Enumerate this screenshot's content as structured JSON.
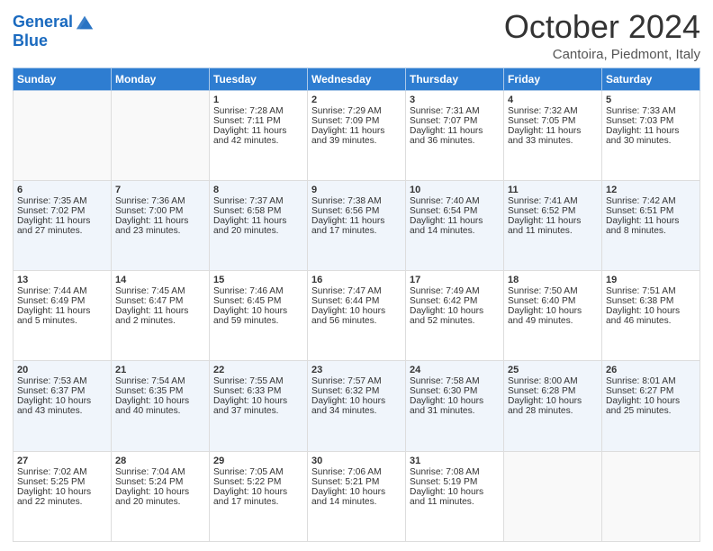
{
  "header": {
    "logo_line1": "General",
    "logo_line2": "Blue",
    "month": "October 2024",
    "location": "Cantoira, Piedmont, Italy"
  },
  "weekdays": [
    "Sunday",
    "Monday",
    "Tuesday",
    "Wednesday",
    "Thursday",
    "Friday",
    "Saturday"
  ],
  "weeks": [
    [
      {
        "day": "",
        "sunrise": "",
        "sunset": "",
        "daylight": ""
      },
      {
        "day": "",
        "sunrise": "",
        "sunset": "",
        "daylight": ""
      },
      {
        "day": "1",
        "sunrise": "Sunrise: 7:28 AM",
        "sunset": "Sunset: 7:11 PM",
        "daylight": "Daylight: 11 hours and 42 minutes."
      },
      {
        "day": "2",
        "sunrise": "Sunrise: 7:29 AM",
        "sunset": "Sunset: 7:09 PM",
        "daylight": "Daylight: 11 hours and 39 minutes."
      },
      {
        "day": "3",
        "sunrise": "Sunrise: 7:31 AM",
        "sunset": "Sunset: 7:07 PM",
        "daylight": "Daylight: 11 hours and 36 minutes."
      },
      {
        "day": "4",
        "sunrise": "Sunrise: 7:32 AM",
        "sunset": "Sunset: 7:05 PM",
        "daylight": "Daylight: 11 hours and 33 minutes."
      },
      {
        "day": "5",
        "sunrise": "Sunrise: 7:33 AM",
        "sunset": "Sunset: 7:03 PM",
        "daylight": "Daylight: 11 hours and 30 minutes."
      }
    ],
    [
      {
        "day": "6",
        "sunrise": "Sunrise: 7:35 AM",
        "sunset": "Sunset: 7:02 PM",
        "daylight": "Daylight: 11 hours and 27 minutes."
      },
      {
        "day": "7",
        "sunrise": "Sunrise: 7:36 AM",
        "sunset": "Sunset: 7:00 PM",
        "daylight": "Daylight: 11 hours and 23 minutes."
      },
      {
        "day": "8",
        "sunrise": "Sunrise: 7:37 AM",
        "sunset": "Sunset: 6:58 PM",
        "daylight": "Daylight: 11 hours and 20 minutes."
      },
      {
        "day": "9",
        "sunrise": "Sunrise: 7:38 AM",
        "sunset": "Sunset: 6:56 PM",
        "daylight": "Daylight: 11 hours and 17 minutes."
      },
      {
        "day": "10",
        "sunrise": "Sunrise: 7:40 AM",
        "sunset": "Sunset: 6:54 PM",
        "daylight": "Daylight: 11 hours and 14 minutes."
      },
      {
        "day": "11",
        "sunrise": "Sunrise: 7:41 AM",
        "sunset": "Sunset: 6:52 PM",
        "daylight": "Daylight: 11 hours and 11 minutes."
      },
      {
        "day": "12",
        "sunrise": "Sunrise: 7:42 AM",
        "sunset": "Sunset: 6:51 PM",
        "daylight": "Daylight: 11 hours and 8 minutes."
      }
    ],
    [
      {
        "day": "13",
        "sunrise": "Sunrise: 7:44 AM",
        "sunset": "Sunset: 6:49 PM",
        "daylight": "Daylight: 11 hours and 5 minutes."
      },
      {
        "day": "14",
        "sunrise": "Sunrise: 7:45 AM",
        "sunset": "Sunset: 6:47 PM",
        "daylight": "Daylight: 11 hours and 2 minutes."
      },
      {
        "day": "15",
        "sunrise": "Sunrise: 7:46 AM",
        "sunset": "Sunset: 6:45 PM",
        "daylight": "Daylight: 10 hours and 59 minutes."
      },
      {
        "day": "16",
        "sunrise": "Sunrise: 7:47 AM",
        "sunset": "Sunset: 6:44 PM",
        "daylight": "Daylight: 10 hours and 56 minutes."
      },
      {
        "day": "17",
        "sunrise": "Sunrise: 7:49 AM",
        "sunset": "Sunset: 6:42 PM",
        "daylight": "Daylight: 10 hours and 52 minutes."
      },
      {
        "day": "18",
        "sunrise": "Sunrise: 7:50 AM",
        "sunset": "Sunset: 6:40 PM",
        "daylight": "Daylight: 10 hours and 49 minutes."
      },
      {
        "day": "19",
        "sunrise": "Sunrise: 7:51 AM",
        "sunset": "Sunset: 6:38 PM",
        "daylight": "Daylight: 10 hours and 46 minutes."
      }
    ],
    [
      {
        "day": "20",
        "sunrise": "Sunrise: 7:53 AM",
        "sunset": "Sunset: 6:37 PM",
        "daylight": "Daylight: 10 hours and 43 minutes."
      },
      {
        "day": "21",
        "sunrise": "Sunrise: 7:54 AM",
        "sunset": "Sunset: 6:35 PM",
        "daylight": "Daylight: 10 hours and 40 minutes."
      },
      {
        "day": "22",
        "sunrise": "Sunrise: 7:55 AM",
        "sunset": "Sunset: 6:33 PM",
        "daylight": "Daylight: 10 hours and 37 minutes."
      },
      {
        "day": "23",
        "sunrise": "Sunrise: 7:57 AM",
        "sunset": "Sunset: 6:32 PM",
        "daylight": "Daylight: 10 hours and 34 minutes."
      },
      {
        "day": "24",
        "sunrise": "Sunrise: 7:58 AM",
        "sunset": "Sunset: 6:30 PM",
        "daylight": "Daylight: 10 hours and 31 minutes."
      },
      {
        "day": "25",
        "sunrise": "Sunrise: 8:00 AM",
        "sunset": "Sunset: 6:28 PM",
        "daylight": "Daylight: 10 hours and 28 minutes."
      },
      {
        "day": "26",
        "sunrise": "Sunrise: 8:01 AM",
        "sunset": "Sunset: 6:27 PM",
        "daylight": "Daylight: 10 hours and 25 minutes."
      }
    ],
    [
      {
        "day": "27",
        "sunrise": "Sunrise: 7:02 AM",
        "sunset": "Sunset: 5:25 PM",
        "daylight": "Daylight: 10 hours and 22 minutes."
      },
      {
        "day": "28",
        "sunrise": "Sunrise: 7:04 AM",
        "sunset": "Sunset: 5:24 PM",
        "daylight": "Daylight: 10 hours and 20 minutes."
      },
      {
        "day": "29",
        "sunrise": "Sunrise: 7:05 AM",
        "sunset": "Sunset: 5:22 PM",
        "daylight": "Daylight: 10 hours and 17 minutes."
      },
      {
        "day": "30",
        "sunrise": "Sunrise: 7:06 AM",
        "sunset": "Sunset: 5:21 PM",
        "daylight": "Daylight: 10 hours and 14 minutes."
      },
      {
        "day": "31",
        "sunrise": "Sunrise: 7:08 AM",
        "sunset": "Sunset: 5:19 PM",
        "daylight": "Daylight: 10 hours and 11 minutes."
      },
      {
        "day": "",
        "sunrise": "",
        "sunset": "",
        "daylight": ""
      },
      {
        "day": "",
        "sunrise": "",
        "sunset": "",
        "daylight": ""
      }
    ]
  ]
}
